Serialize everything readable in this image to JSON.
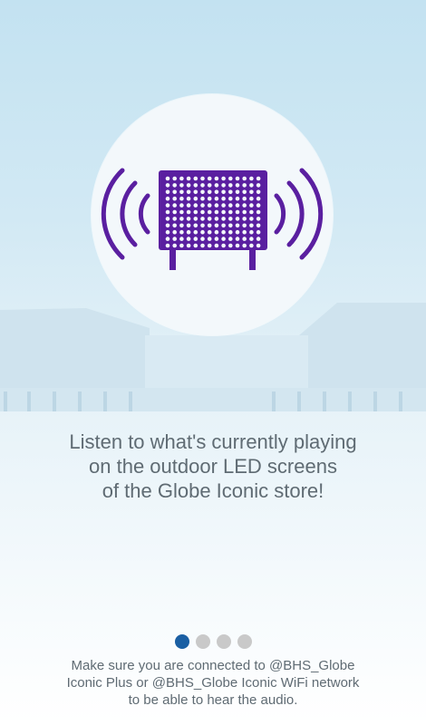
{
  "onboarding": {
    "headline_lines": [
      "Listen to what's currently playing",
      "on the outdoor LED screens",
      "of the Globe Iconic store!"
    ],
    "pages": {
      "count": 4,
      "active": 1
    },
    "footer_lines": [
      "Make sure you are connected to @BHS_Globe",
      "Iconic Plus or @BHS_Globe Iconic WiFi network",
      "to be able to hear the audio."
    ]
  },
  "hero": {
    "icon": "led-screen-sound-icon"
  },
  "colors": {
    "accent": "#5a1fa0",
    "active_dot": "#1a5fa3",
    "inactive_dot": "#c9c9c9",
    "text": "#5f6b73",
    "circle": "#f3f8fb"
  }
}
